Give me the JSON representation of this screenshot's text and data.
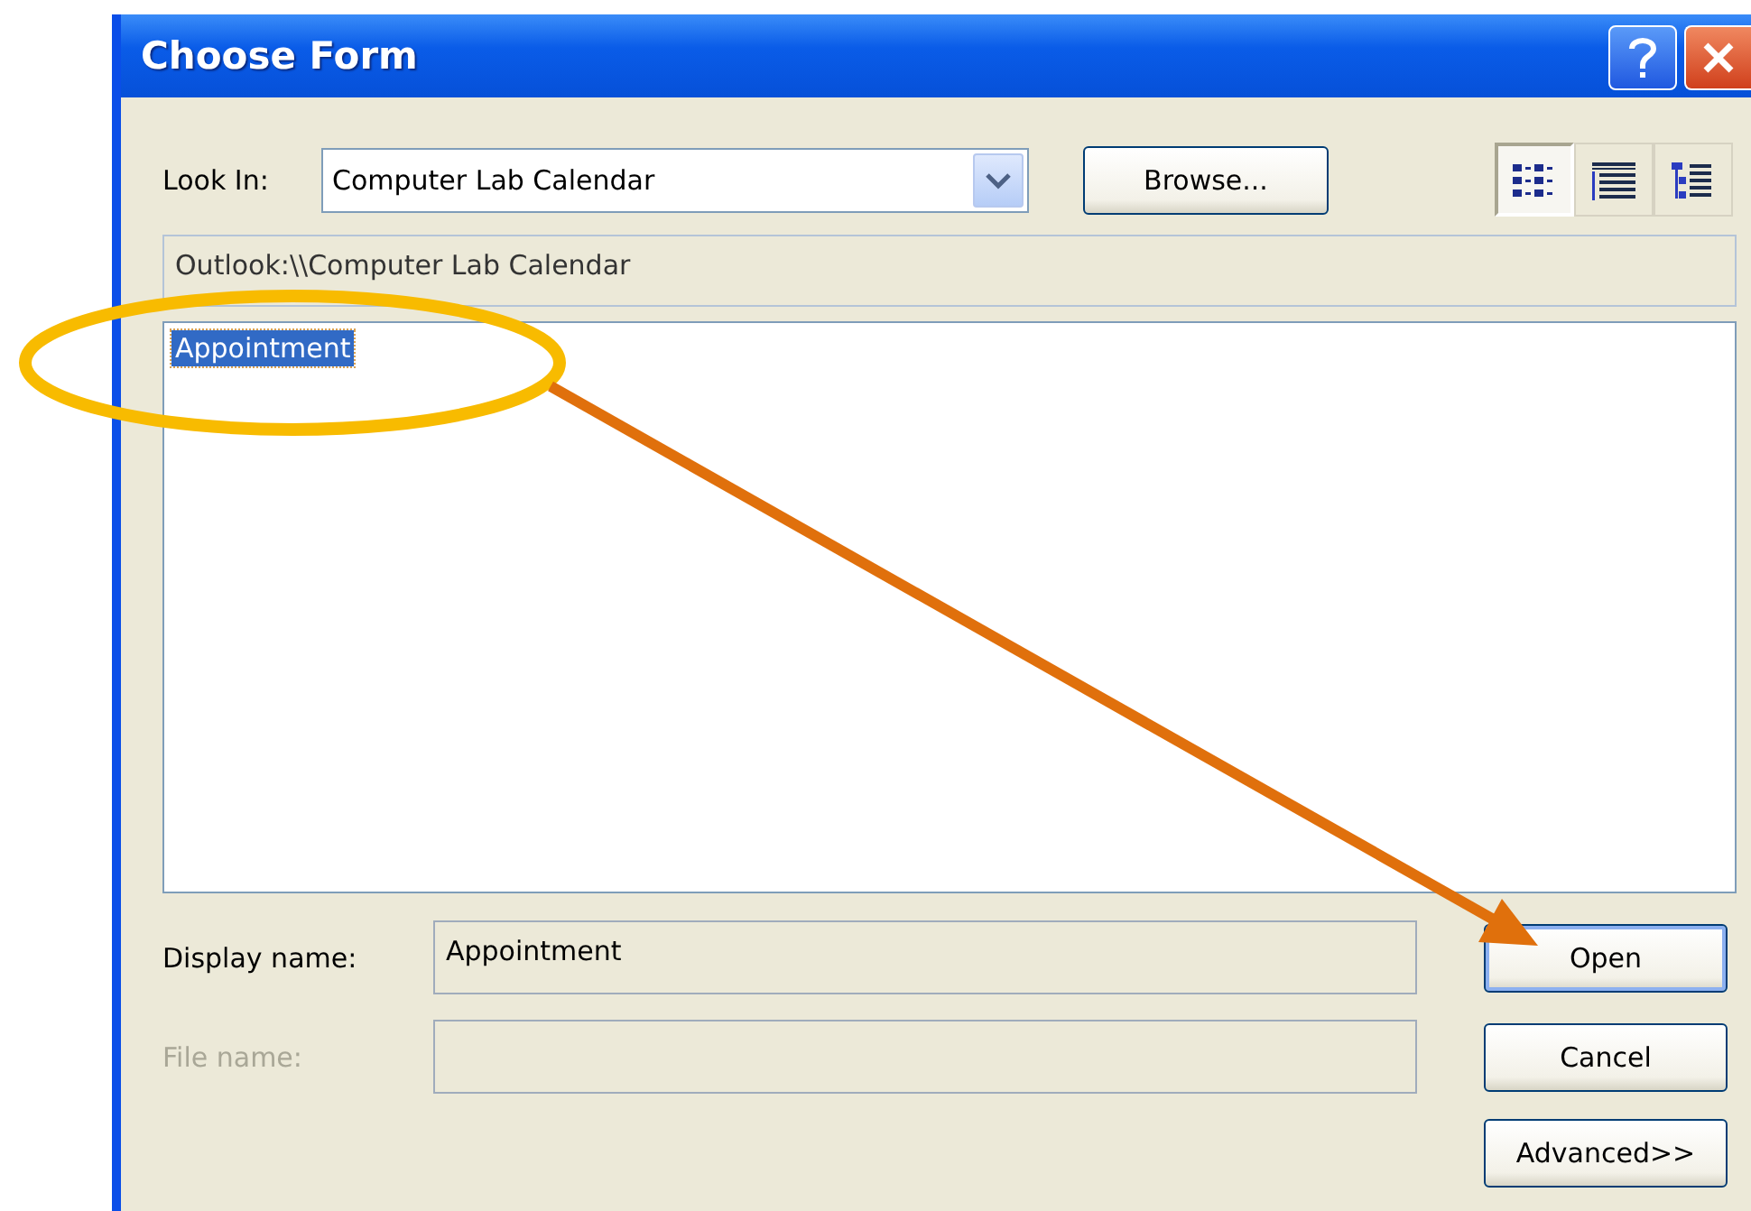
{
  "window": {
    "title": "Choose Form",
    "controls": [
      {
        "kind": "help"
      },
      {
        "kind": "close"
      }
    ]
  },
  "look_in": {
    "label": "Look In:",
    "value": "Computer Lab Calendar"
  },
  "browse_button": {
    "label": "Browse..."
  },
  "view_modes": [
    {
      "kind": "list",
      "selected": true
    },
    {
      "kind": "details",
      "selected": false
    },
    {
      "kind": "tree",
      "selected": false
    }
  ],
  "path": {
    "value": "Outlook:\\\\Computer Lab Calendar"
  },
  "forms": [
    {
      "label": "Appointment",
      "selected": true
    }
  ],
  "display_name": {
    "label": "Display name:",
    "value": "Appointment",
    "disabled": false
  },
  "file_name": {
    "label": "File name:",
    "disabled": true
  },
  "buttons": [
    {
      "label": "Open",
      "default": true
    },
    {
      "label": "Cancel",
      "default": false
    },
    {
      "label": "Advanced>>",
      "default": false
    }
  ]
}
